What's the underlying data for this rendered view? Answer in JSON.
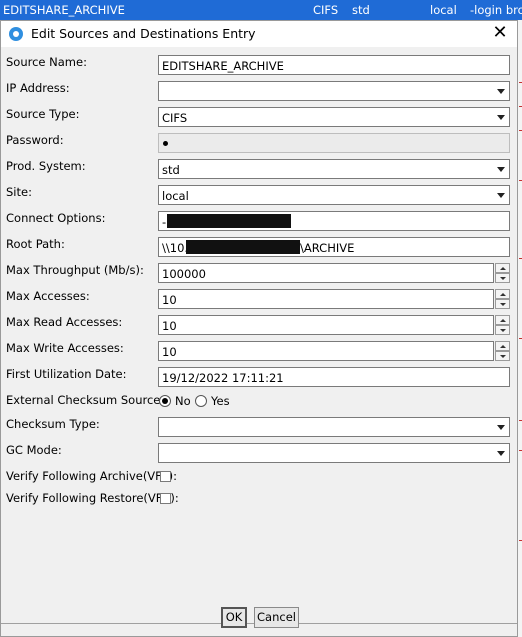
{
  "background_row": {
    "name": "EDITSHARE_ARCHIVE",
    "type": "CIFS",
    "prod": "std",
    "site": "local",
    "options": "-login broa"
  },
  "dialog": {
    "title": "Edit Sources and Destinations Entry",
    "close_glyph": "✕"
  },
  "form": {
    "source_name": {
      "label": "Source Name:",
      "value": "EDITSHARE_ARCHIVE"
    },
    "ip_address": {
      "label": "IP Address:",
      "value": ""
    },
    "source_type": {
      "label": "Source Type:",
      "value": "CIFS"
    },
    "password": {
      "label": "Password:"
    },
    "prod_system": {
      "label": "Prod. System:",
      "value": "std"
    },
    "site": {
      "label": "Site:",
      "value": "local"
    },
    "connect_options": {
      "label": "Connect Options:",
      "value": "-"
    },
    "root_path": {
      "label": "Root Path:",
      "prefix": "\\\\10.",
      "suffix": "\\ARCHIVE"
    },
    "max_throughput": {
      "label": "Max Throughput (Mb/s):",
      "value": "100000"
    },
    "max_accesses": {
      "label": "Max Accesses:",
      "value": "10"
    },
    "max_read_accesses": {
      "label": "Max Read Accesses:",
      "value": "10"
    },
    "max_write_accesses": {
      "label": "Max Write Accesses:",
      "value": "10"
    },
    "first_utilization_date": {
      "label": "First Utilization Date:",
      "value": "19/12/2022 17:11:21"
    },
    "external_checksum_source": {
      "label": "External Checksum Source:",
      "option_no": "No",
      "option_yes": "Yes",
      "selected": "No"
    },
    "checksum_type": {
      "label": "Checksum Type:",
      "value": ""
    },
    "gc_mode": {
      "label": "GC Mode:",
      "value": ""
    },
    "verify_archive": {
      "label": "Verify Following Archive(VFA):",
      "checked": false
    },
    "verify_restore": {
      "label": "Verify Following Restore(VFR):",
      "checked": false
    }
  },
  "buttons": {
    "ok": "OK",
    "cancel": "Cancel"
  },
  "icons": {
    "dialog_icon": "radio-circle-icon",
    "close": "close-icon",
    "dropdown": "chevron-down-icon",
    "spinner": "spinner-arrows-icon"
  },
  "colors": {
    "selection": "#1f6bd6",
    "dialog_bg": "#f0f0f0"
  }
}
